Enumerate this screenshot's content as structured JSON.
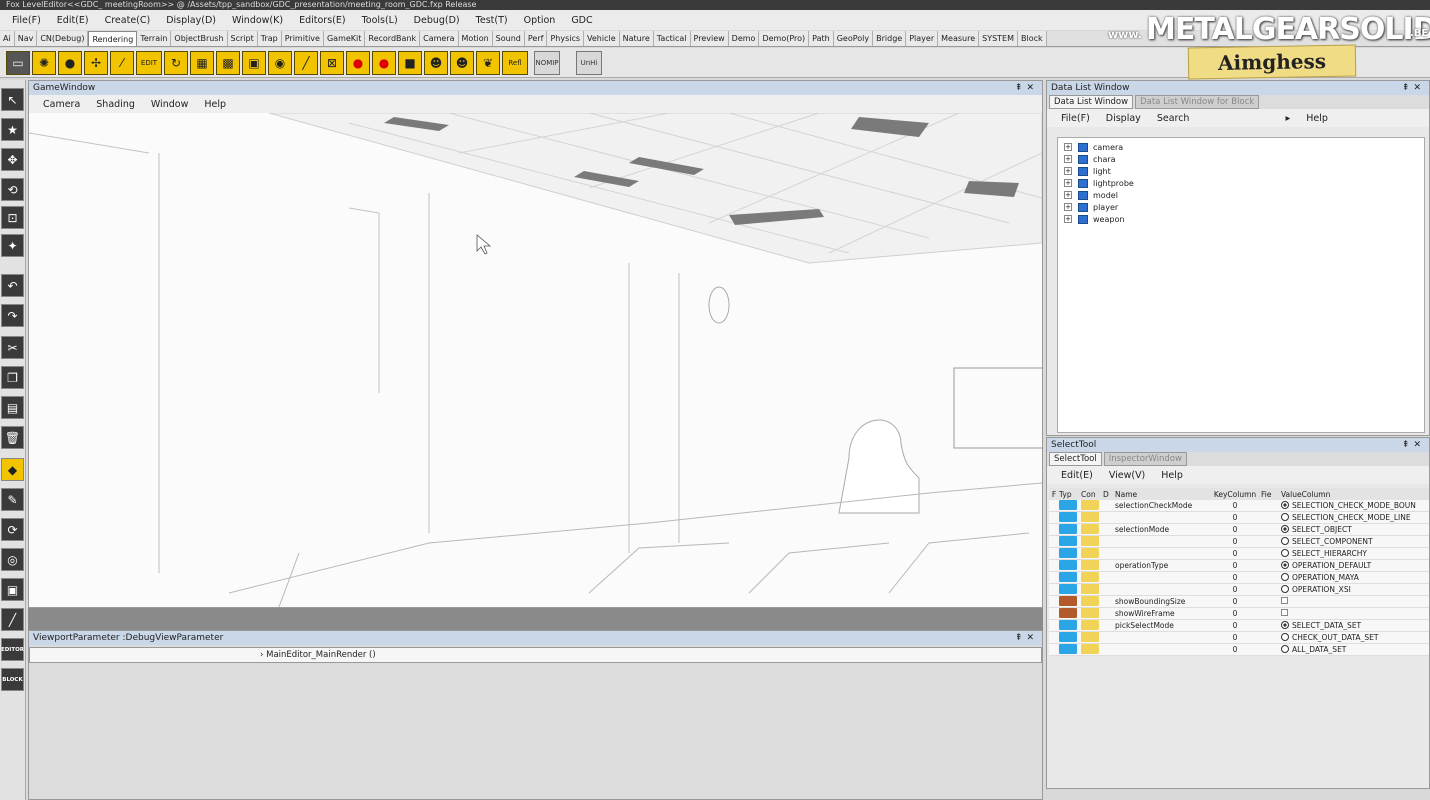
{
  "titlebar": "Fox LevelEditor<<GDC_ meetingRoom>> @ /Assets/tpp_sandbox/GDC_presentation/meeting_room_GDC.fxp  Release",
  "menubar": [
    "File(F)",
    "Edit(E)",
    "Create(C)",
    "Display(D)",
    "Window(K)",
    "Editors(E)",
    "Tools(L)",
    "Debug(D)",
    "Test(T)",
    "Option",
    "GDC"
  ],
  "tabs": [
    "Ai",
    "Nav",
    "CN(Debug)",
    "Rendering",
    "Terrain",
    "ObjectBrush",
    "Script",
    "Trap",
    "Primitive",
    "GameKit",
    "RecordBank",
    "Camera",
    "Motion",
    "Sound",
    "Perf",
    "Physics",
    "Vehicle",
    "Nature",
    "Tactical",
    "Preview",
    "Demo",
    "Demo(Pro)",
    "Path",
    "GeoPoly",
    "Bridge",
    "Player",
    "Measure",
    "SYSTEM",
    "Block"
  ],
  "active_tab": "Rendering",
  "toolbar": {
    "refl_label": "Refl",
    "nomp_label": "NOMIP",
    "unhi_label": "UnHi"
  },
  "left_buttons": {
    "editor_label": "EDITOR",
    "block_label": "BLOCK"
  },
  "gamewindow": {
    "title": "GameWindow",
    "menu": [
      "Camera",
      "Shading",
      "Window",
      "Help"
    ]
  },
  "viewport_param": {
    "title": "ViewportParameter :DebugViewParameter",
    "row": "MainEditor_MainRender ()"
  },
  "datalist": {
    "title": "Data List Window",
    "tabs": [
      "Data List Window",
      "Data List Window for Block"
    ],
    "menu": [
      "File(F)",
      "Display",
      "Search",
      "Help"
    ],
    "tree": [
      "camera",
      "chara",
      "light",
      "lightprobe",
      "model",
      "player",
      "weapon"
    ]
  },
  "selecttool": {
    "title": "SelectTool",
    "tabs": [
      "SelectTool",
      "InspectorWindow"
    ],
    "menu": [
      "Edit(E)",
      "View(V)",
      "Help"
    ],
    "headers": {
      "f": "F",
      "type": "Typ",
      "con": "Con",
      "d": "D",
      "name": "Name",
      "key": "KeyColumn",
      "fi": "Fie",
      "value": "ValueColumn"
    },
    "rows": [
      {
        "type": "int",
        "name": "selectionCheckMode",
        "key": "0",
        "value": "SELECTION_CHECK_MODE_BOUN",
        "radio": true,
        "on": true
      },
      {
        "type": "int",
        "name": "",
        "key": "0",
        "value": "SELECTION_CHECK_MODE_LINE",
        "radio": true,
        "on": false
      },
      {
        "type": "int",
        "name": "selectionMode",
        "key": "0",
        "value": "SELECT_OBJECT",
        "radio": true,
        "on": true
      },
      {
        "type": "int",
        "name": "",
        "key": "0",
        "value": "SELECT_COMPONENT",
        "radio": true,
        "on": false
      },
      {
        "type": "int",
        "name": "",
        "key": "0",
        "value": "SELECT_HIERARCHY",
        "radio": true,
        "on": false
      },
      {
        "type": "int",
        "name": "operationType",
        "key": "0",
        "value": "OPERATION_DEFAULT",
        "radio": true,
        "on": true
      },
      {
        "type": "int",
        "name": "",
        "key": "0",
        "value": "OPERATION_MAYA",
        "radio": true,
        "on": false
      },
      {
        "type": "int",
        "name": "",
        "key": "0",
        "value": "OPERATION_XSI",
        "radio": true,
        "on": false
      },
      {
        "type": "bool",
        "name": "showBoundingSize",
        "key": "0",
        "value": "",
        "radio": false,
        "on": false
      },
      {
        "type": "bool",
        "name": "showWireFrame",
        "key": "0",
        "value": "",
        "radio": false,
        "on": false
      },
      {
        "type": "int",
        "name": "pickSelectMode",
        "key": "0",
        "value": "SELECT_DATA_SET",
        "radio": true,
        "on": true
      },
      {
        "type": "int",
        "name": "",
        "key": "0",
        "value": "CHECK_OUT_DATA_SET",
        "radio": true,
        "on": false
      },
      {
        "type": "int",
        "name": "",
        "key": "0",
        "value": "ALL_DATA_SET",
        "radio": true,
        "on": false
      }
    ]
  },
  "watermark": {
    "prefix": "www.",
    "brand": "METALGEARSOLID",
    "suffix": ".BE",
    "tag": "Aimghess"
  }
}
